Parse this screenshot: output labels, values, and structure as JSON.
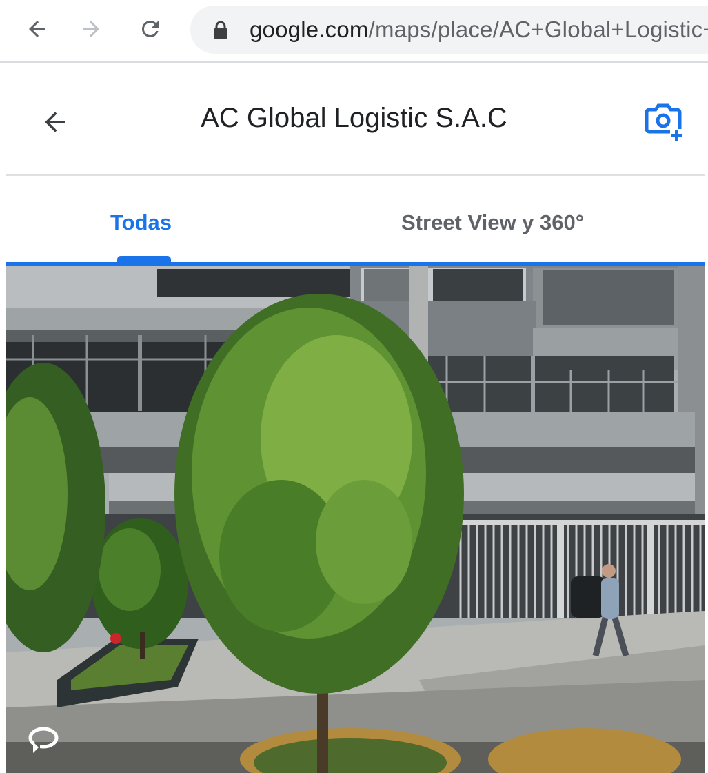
{
  "browser": {
    "url_host": "google.com",
    "url_path": "/maps/place/AC+Global+Logistic+S.A.C",
    "icons": {
      "back": "arrow-left-icon",
      "forward": "arrow-right-icon",
      "reload": "reload-icon",
      "lock": "lock-icon"
    }
  },
  "header": {
    "title": "AC Global Logistic S.A.C",
    "icons": {
      "back": "arrow-left-icon",
      "add_photo": "add-photo-camera-icon"
    }
  },
  "tabs": [
    {
      "label": "Todas",
      "active": true
    },
    {
      "label": "Street View y 360°",
      "active": false
    }
  ],
  "photo": {
    "controls": {
      "rotate": "rotate-360-icon"
    }
  },
  "colors": {
    "accent": "#1a73e8",
    "text_primary": "#202124",
    "text_secondary": "#5f6368",
    "omnibox_bg": "#f1f3f4"
  }
}
